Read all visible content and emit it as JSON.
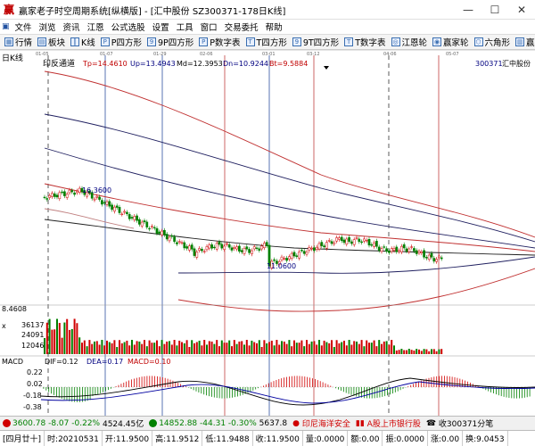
{
  "window": {
    "title": "赢家老子时空周期系统[纵横版] - [汇中股份  SZ300371-178日K线]",
    "app_icon": "赢",
    "minimize": "—",
    "maximize": "☐",
    "close": "✕"
  },
  "menu": [
    "文件",
    "浏览",
    "资讯",
    "江恩",
    "公式选股",
    "设置",
    "工具",
    "窗口",
    "交易委托",
    "帮助"
  ],
  "toolbar": [
    "行情",
    "板块",
    "K线",
    "P四方形",
    "9P四方形",
    "P数字表",
    "T四方形",
    "9T四方形",
    "T数字表",
    "江恩轮",
    "赢家轮",
    "六角形",
    "赢家股务"
  ],
  "chart": {
    "panel_label": "日K线",
    "indicator_label": "印反通道",
    "tp": "Tp=14.4610",
    "up": "Up=13.4943",
    "md": "Md=12.3953",
    "dn": "Dn=10.9244",
    "bt": "Bt=9.5884",
    "stock_code": "300371",
    "stock_name": "汇中股份",
    "high_label": "16.3600",
    "low_label": "11.0600",
    "vol_bottom_label": "8.4608",
    "vol_ticks": [
      "36137",
      "24091",
      "12046"
    ],
    "vol_axis_label": "x",
    "macd_label": "MACD",
    "dif": "DIF=0.12",
    "dea": "DEA=0.17",
    "macd": "MACD=0.10",
    "macd_ticks": [
      "0.22",
      "0.02",
      "-0.18",
      "-0.38"
    ],
    "date_ticks": [
      "01-05",
      "01-07",
      "01-29",
      "02-06",
      "03-01",
      "03-12",
      "04-06",
      "05-07"
    ]
  },
  "status1": {
    "sh": "3600.78",
    "sh_chg": "-8.07",
    "sh_pct": "-0.22%",
    "sh_amt": "4524.45亿",
    "sz": "14852.88",
    "sz_chg": "-44.31",
    "sz_pct": "-0.30%",
    "sz_amt": "5637.8",
    "news1": "印尼海洋安全",
    "news2": "A股上市银行股",
    "news3": "收300371分笔"
  },
  "status2": {
    "cell1": "[四月廿十]",
    "cell2": "时:20210531",
    "cell3": "开:11.9500",
    "cell4": "高:11.9512",
    "cell5": "低:11.9488",
    "cell6": "收:11.9500",
    "cell7": "量:0.0000",
    "cell8": "额:0.00",
    "cell9": "振:0.0000",
    "cell10": "涨:0.00",
    "cell11": "换:9.0453"
  },
  "colors": {
    "up": "#d00000",
    "down": "#008000",
    "band_outer": "#c03030",
    "band_inner": "#202060",
    "vline_blue": "#3050a0",
    "vline_red": "#c04040"
  }
}
